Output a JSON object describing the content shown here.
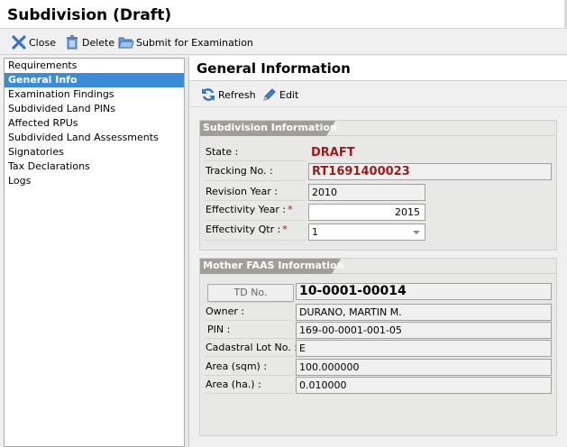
{
  "window": {
    "title": "Subdivision (Draft)"
  },
  "toolbar": {
    "close_label": "Close",
    "delete_label": "Delete",
    "submit_label": "Submit for Examination"
  },
  "nav": {
    "items": [
      {
        "label": "Requirements"
      },
      {
        "label": "General Info"
      },
      {
        "label": "Examination Findings"
      },
      {
        "label": "Subdivided Land PINs"
      },
      {
        "label": "Affected RPUs"
      },
      {
        "label": "Subdivided Land Assessments"
      },
      {
        "label": "Signatories"
      },
      {
        "label": "Tax Declarations"
      },
      {
        "label": "Logs"
      }
    ],
    "selected": "General Info"
  },
  "main": {
    "title": "General Information",
    "refresh_label": "Refresh",
    "edit_label": "Edit"
  },
  "subdivision_info": {
    "heading": "Subdivision Information",
    "state_label": "State :",
    "state_value": "DRAFT",
    "tracking_label": "Tracking No. :",
    "tracking_value": "RT1691400023",
    "revision_year_label": "Revision Year :",
    "revision_year_value": "2010",
    "effectivity_year_label": "Effectivity Year :",
    "effectivity_year_value": "2015",
    "effectivity_qtr_label": "Effectivity Qtr :",
    "effectivity_qtr_value": "1",
    "required_mark": "*"
  },
  "mother_faas": {
    "heading": "Mother FAAS Information",
    "td_button_label": "TD No.",
    "td_no_value": "10-0001-00014",
    "owner_label": "Owner :",
    "owner_value": "DURANO, MARTIN M.",
    "pin_label": "PIN :",
    "pin_value": "169-00-0001-001-05",
    "cadastral_label": "Cadastral Lot No. :",
    "cadastral_value": "E",
    "area_sqm_label": "Area (sqm) :",
    "area_sqm_value": "100.000000",
    "area_ha_label": "Area (ha.) :",
    "area_ha_value": "0.010000"
  },
  "colors": {
    "selection": "#3c8bd6",
    "section_tab": "#a09e96",
    "state_text": "#9b1b1b",
    "required": "#d00000"
  }
}
